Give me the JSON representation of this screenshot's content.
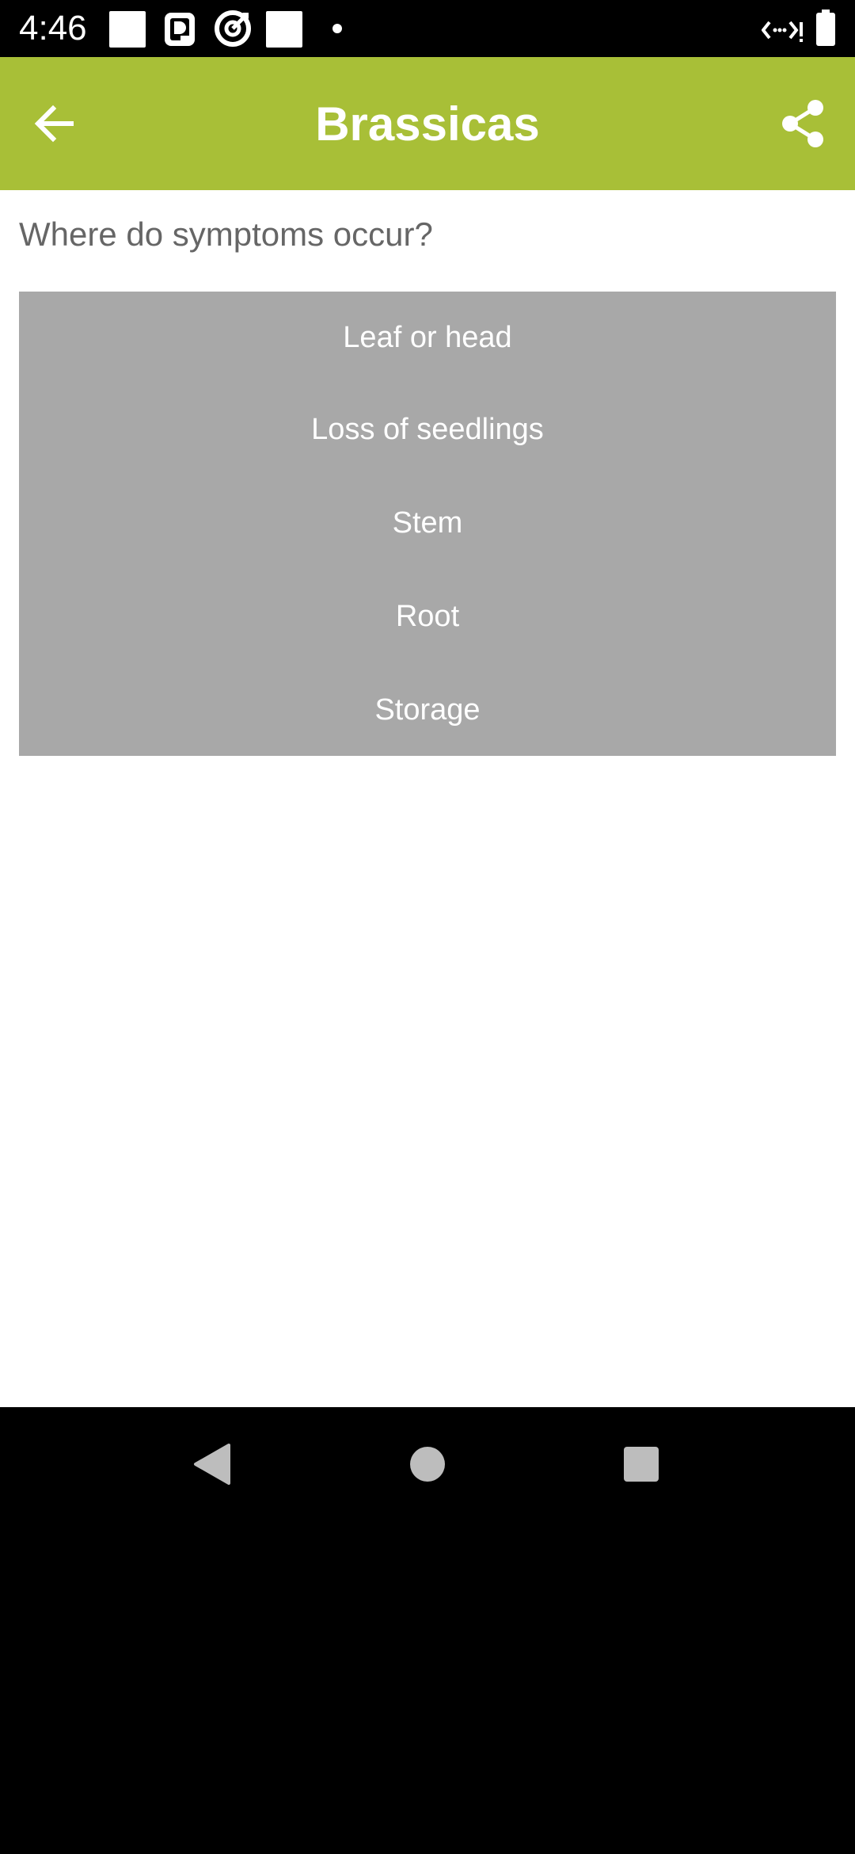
{
  "status_bar": {
    "time": "4:46",
    "icons": [
      "notification-square-icon",
      "app-notification-icon",
      "target-app-icon",
      "notification-square-icon",
      "more-notifications-dot-icon",
      "data-signal-icon",
      "battery-icon"
    ]
  },
  "app_bar": {
    "title": "Brassicas",
    "background_color": "#a8bf37",
    "left_icon": "back-arrow-icon",
    "right_icon": "share-icon"
  },
  "main": {
    "question": "Where do symptoms occur?",
    "options_background": "#a8a8a8",
    "options": [
      {
        "label": "Leaf or head"
      },
      {
        "label": "Loss of seedlings"
      },
      {
        "label": "Stem"
      },
      {
        "label": "Root"
      },
      {
        "label": "Storage"
      }
    ]
  },
  "nav_bar": {
    "buttons": [
      "back-triangle-icon",
      "home-circle-icon",
      "recents-square-icon"
    ]
  }
}
